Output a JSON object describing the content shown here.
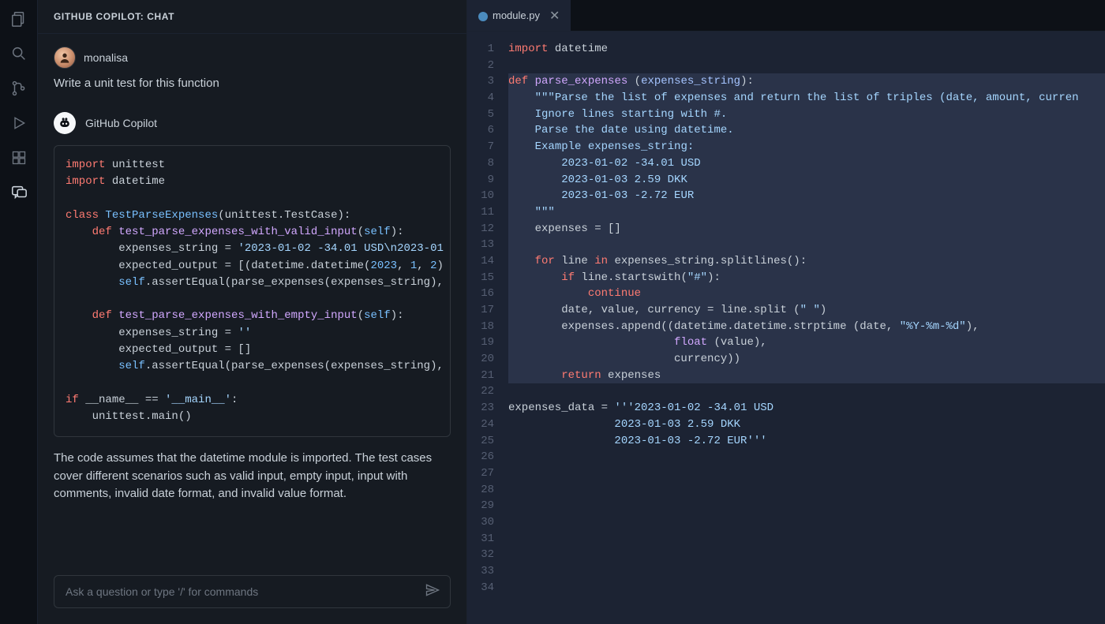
{
  "activity_bar": {
    "icons": [
      "files-icon",
      "search-icon",
      "git-icon",
      "run-icon",
      "extensions-icon",
      "chat-icon"
    ]
  },
  "chat": {
    "title": "GITHUB COPILOT: CHAT",
    "user": {
      "name": "monalisa",
      "prompt": "Write a unit test for this function"
    },
    "bot": {
      "name": "GitHub Copilot",
      "code_lines": [
        {
          "t": [
            {
              "c": "kw",
              "v": "import"
            },
            {
              "c": "",
              "v": " unittest"
            }
          ]
        },
        {
          "t": [
            {
              "c": "kw",
              "v": "import"
            },
            {
              "c": "",
              "v": " datetime"
            }
          ]
        },
        {
          "t": []
        },
        {
          "t": [
            {
              "c": "kw",
              "v": "class"
            },
            {
              "c": "",
              "v": " "
            },
            {
              "c": "cls",
              "v": "TestParseExpenses"
            },
            {
              "c": "",
              "v": "(unittest.TestCase):"
            }
          ]
        },
        {
          "t": [
            {
              "c": "",
              "v": "    "
            },
            {
              "c": "kw",
              "v": "def"
            },
            {
              "c": "",
              "v": " "
            },
            {
              "c": "fn",
              "v": "test_parse_expenses_with_valid_input"
            },
            {
              "c": "",
              "v": "("
            },
            {
              "c": "self",
              "v": "self"
            },
            {
              "c": "",
              "v": "):"
            }
          ]
        },
        {
          "t": [
            {
              "c": "",
              "v": "        expenses_string = "
            },
            {
              "c": "str",
              "v": "'2023-01-02 -34.01 USD\\n2023-01"
            }
          ]
        },
        {
          "t": [
            {
              "c": "",
              "v": "        expected_output = [(datetime.datetime("
            },
            {
              "c": "num",
              "v": "2023"
            },
            {
              "c": "",
              "v": ", "
            },
            {
              "c": "num",
              "v": "1"
            },
            {
              "c": "",
              "v": ", "
            },
            {
              "c": "num",
              "v": "2"
            },
            {
              "c": "",
              "v": ")"
            }
          ]
        },
        {
          "t": [
            {
              "c": "",
              "v": "        "
            },
            {
              "c": "self",
              "v": "self"
            },
            {
              "c": "",
              "v": ".assertEqual(parse_expenses(expenses_string),"
            }
          ]
        },
        {
          "t": []
        },
        {
          "t": [
            {
              "c": "",
              "v": "    "
            },
            {
              "c": "kw",
              "v": "def"
            },
            {
              "c": "",
              "v": " "
            },
            {
              "c": "fn",
              "v": "test_parse_expenses_with_empty_input"
            },
            {
              "c": "",
              "v": "("
            },
            {
              "c": "self",
              "v": "self"
            },
            {
              "c": "",
              "v": "):"
            }
          ]
        },
        {
          "t": [
            {
              "c": "",
              "v": "        expenses_string = "
            },
            {
              "c": "str",
              "v": "''"
            }
          ]
        },
        {
          "t": [
            {
              "c": "",
              "v": "        expected_output = []"
            }
          ]
        },
        {
          "t": [
            {
              "c": "",
              "v": "        "
            },
            {
              "c": "self",
              "v": "self"
            },
            {
              "c": "",
              "v": ".assertEqual(parse_expenses(expenses_string),"
            }
          ]
        },
        {
          "t": []
        },
        {
          "t": [
            {
              "c": "kw",
              "v": "if"
            },
            {
              "c": "",
              "v": " __name__ == "
            },
            {
              "c": "str",
              "v": "'__main__'"
            },
            {
              "c": "",
              "v": ":"
            }
          ]
        },
        {
          "t": [
            {
              "c": "",
              "v": "    unittest.main()"
            }
          ]
        }
      ],
      "explanation": "The code assumes that the datetime module is imported. The test cases cover different scenarios such as valid input, empty input, input with comments, invalid date format, and invalid value format."
    },
    "input_placeholder": "Ask a question or type '/' for commands"
  },
  "editor": {
    "tab": {
      "filename": "module.py",
      "close_glyph": "✕"
    },
    "line_count": 34,
    "lines": [
      {
        "hl": false,
        "t": [
          {
            "c": "kw",
            "v": "import"
          },
          {
            "c": "",
            "v": " datetime"
          }
        ]
      },
      {
        "hl": false,
        "t": []
      },
      {
        "hl": true,
        "t": [
          {
            "c": "kw",
            "v": "def"
          },
          {
            "c": "",
            "v": " "
          },
          {
            "c": "fn",
            "v": "parse_expenses"
          },
          {
            "c": "",
            "v": " ("
          },
          {
            "c": "par",
            "v": "expenses_string"
          },
          {
            "c": "",
            "v": "):"
          }
        ]
      },
      {
        "hl": true,
        "t": [
          {
            "c": "",
            "v": "    "
          },
          {
            "c": "str",
            "v": "\"\"\"Parse the list of expenses and return the list of triples (date, amount, curren"
          }
        ]
      },
      {
        "hl": true,
        "t": [
          {
            "c": "",
            "v": "    "
          },
          {
            "c": "str",
            "v": "Ignore lines starting with #."
          }
        ]
      },
      {
        "hl": true,
        "t": [
          {
            "c": "",
            "v": "    "
          },
          {
            "c": "str",
            "v": "Parse the date using datetime."
          }
        ]
      },
      {
        "hl": true,
        "t": [
          {
            "c": "",
            "v": "    "
          },
          {
            "c": "str",
            "v": "Example expenses_string:"
          }
        ]
      },
      {
        "hl": true,
        "t": [
          {
            "c": "",
            "v": "        "
          },
          {
            "c": "str",
            "v": "2023-01-02 -34.01 USD"
          }
        ]
      },
      {
        "hl": true,
        "t": [
          {
            "c": "",
            "v": "        "
          },
          {
            "c": "str",
            "v": "2023-01-03 2.59 DKK"
          }
        ]
      },
      {
        "hl": true,
        "t": [
          {
            "c": "",
            "v": "        "
          },
          {
            "c": "str",
            "v": "2023-01-03 -2.72 EUR"
          }
        ]
      },
      {
        "hl": true,
        "t": [
          {
            "c": "",
            "v": "    "
          },
          {
            "c": "str",
            "v": "\"\"\""
          }
        ]
      },
      {
        "hl": true,
        "t": [
          {
            "c": "",
            "v": "    expenses = []"
          }
        ]
      },
      {
        "hl": true,
        "t": []
      },
      {
        "hl": true,
        "t": [
          {
            "c": "",
            "v": "    "
          },
          {
            "c": "kw",
            "v": "for"
          },
          {
            "c": "",
            "v": " line "
          },
          {
            "c": "kw",
            "v": "in"
          },
          {
            "c": "",
            "v": " expenses_string.splitlines():"
          }
        ]
      },
      {
        "hl": true,
        "t": [
          {
            "c": "",
            "v": "        "
          },
          {
            "c": "kw",
            "v": "if"
          },
          {
            "c": "",
            "v": " line.startswith("
          },
          {
            "c": "str",
            "v": "\"#\""
          },
          {
            "c": "",
            "v": "):"
          }
        ]
      },
      {
        "hl": true,
        "t": [
          {
            "c": "",
            "v": "            "
          },
          {
            "c": "kw",
            "v": "continue"
          }
        ]
      },
      {
        "hl": true,
        "t": [
          {
            "c": "",
            "v": "        date, value, currency = line.split ("
          },
          {
            "c": "str",
            "v": "\" \""
          },
          {
            "c": "",
            "v": ")"
          }
        ]
      },
      {
        "hl": true,
        "t": [
          {
            "c": "",
            "v": "        expenses.append((datetime.datetime.strptime (date, "
          },
          {
            "c": "str",
            "v": "\"%Y-%m-%d\""
          },
          {
            "c": "",
            "v": "),"
          }
        ]
      },
      {
        "hl": true,
        "t": [
          {
            "c": "",
            "v": "                         "
          },
          {
            "c": "fn",
            "v": "float"
          },
          {
            "c": "",
            "v": " (value),"
          }
        ]
      },
      {
        "hl": true,
        "t": [
          {
            "c": "",
            "v": "                         currency))"
          }
        ]
      },
      {
        "hl": true,
        "t": [
          {
            "c": "",
            "v": "        "
          },
          {
            "c": "kw",
            "v": "return"
          },
          {
            "c": "",
            "v": " expenses"
          }
        ]
      },
      {
        "hl": false,
        "t": []
      },
      {
        "hl": false,
        "t": [
          {
            "c": "",
            "v": "expenses_data = "
          },
          {
            "c": "str",
            "v": "'''2023-01-02 -34.01 USD"
          }
        ]
      },
      {
        "hl": false,
        "t": [
          {
            "c": "",
            "v": "                "
          },
          {
            "c": "str",
            "v": "2023-01-03 2.59 DKK"
          }
        ]
      },
      {
        "hl": false,
        "t": [
          {
            "c": "",
            "v": "                "
          },
          {
            "c": "str",
            "v": "2023-01-03 -2.72 EUR'''"
          }
        ]
      },
      {
        "hl": false,
        "t": []
      },
      {
        "hl": false,
        "t": []
      },
      {
        "hl": false,
        "t": []
      },
      {
        "hl": false,
        "t": []
      },
      {
        "hl": false,
        "t": []
      },
      {
        "hl": false,
        "t": []
      },
      {
        "hl": false,
        "t": []
      },
      {
        "hl": false,
        "t": []
      },
      {
        "hl": false,
        "t": []
      }
    ]
  }
}
